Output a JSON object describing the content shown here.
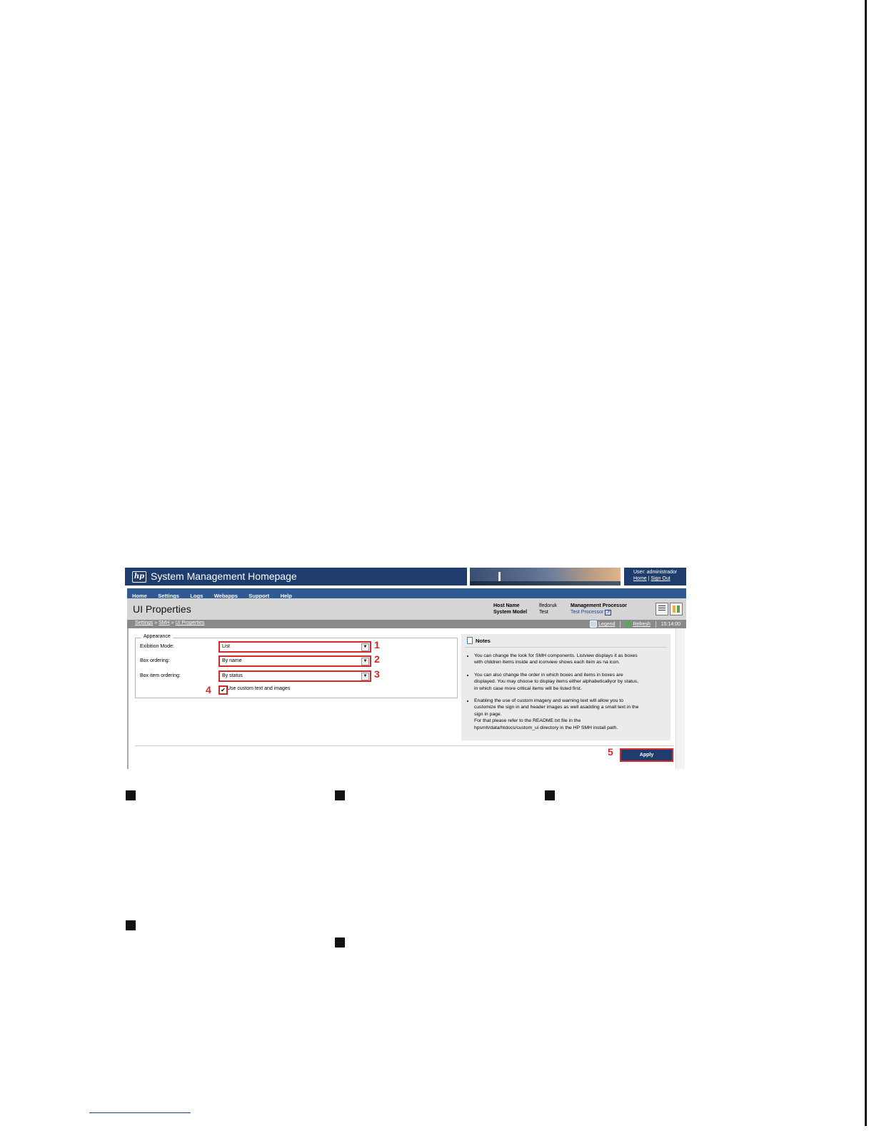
{
  "header": {
    "logo": "hp",
    "app_title": "System Management Homepage",
    "user_text": "User: administrador",
    "home_link": "Home",
    "sign_out_link": "Sign Out",
    "separator": "|"
  },
  "menu": [
    "Home",
    "Settings",
    "Logs",
    "Webapps",
    "Support",
    "Help"
  ],
  "page": {
    "title": "UI Properties",
    "host_name_label": "Host Name",
    "host_name_value": "lfedoruk",
    "system_model_label": "System Model",
    "system_model_value": "Test",
    "mp_label": "Management Processor",
    "mp_value": "Test Processor"
  },
  "breadcrumb": [
    "Settings",
    "SMH",
    "UI Properties"
  ],
  "breadcrumb_sep": "»",
  "toolbar": {
    "legend": "Legend",
    "refresh": "Refresh",
    "time": "15:14:00"
  },
  "appearance": {
    "legend": "Appearance",
    "exhibition_label": "Exibition Mode:",
    "exhibition_value": "List",
    "box_ordering_label": "Box ordering:",
    "box_ordering_value": "By name",
    "box_item_label": "Box item ordering:",
    "box_item_value": "By status",
    "checkbox_label": "Use custom text and images",
    "checkbox_checked": true
  },
  "callouts": [
    "1",
    "2",
    "3",
    "4",
    "5"
  ],
  "notes": {
    "title": "Notes",
    "items": [
      [
        "You can change the look for SMH components. Listview displays it as boxes",
        "with children items inside and iconview shows each item as na icon."
      ],
      [
        "You can also change the order in which boxes and items in boxes are",
        "displayed. You may choose to display items either alphabeticallyor by status,",
        "in which case more critical items will be listed first."
      ],
      [
        "Enabling the use of custom imagery and warning text will allow you to",
        "customize the sign in and header images as well asadding a small text in the",
        "sign in page.",
        "For that please refer to the README.txt file in the",
        "hpsmh/data/htdocs/custom_ui directory in the HP SMH install path."
      ]
    ]
  },
  "apply_button": "Apply",
  "colors": {
    "header_blue": "#1e3d6e",
    "menu_blue": "#2f5a92",
    "callout_red": "#d42a2a"
  }
}
